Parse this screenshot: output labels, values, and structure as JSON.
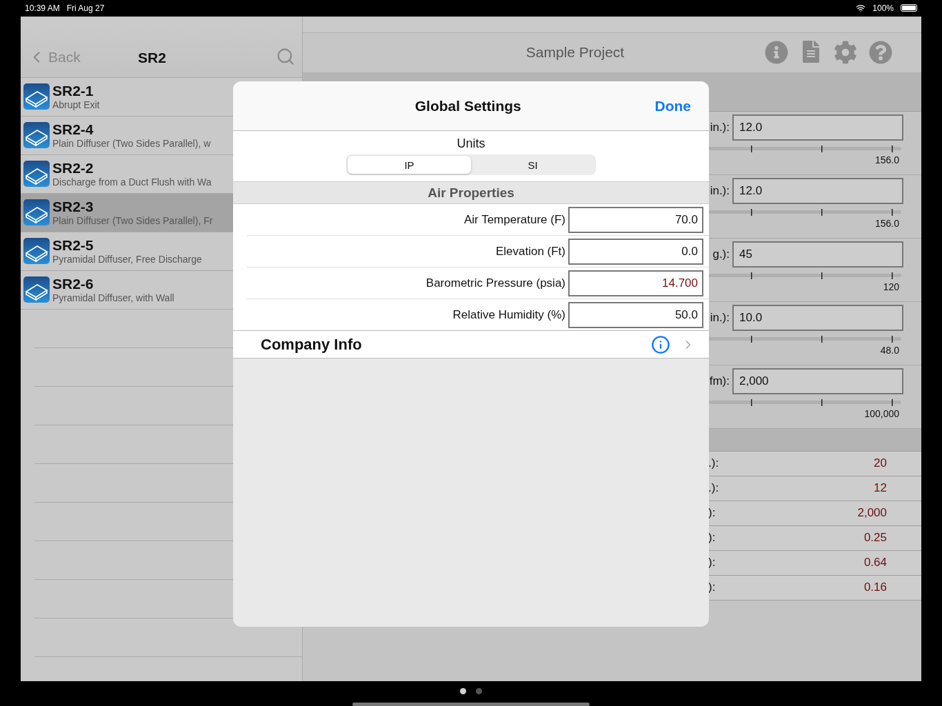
{
  "status_bar": {
    "time": "10:39 AM",
    "date": "Fri Aug 27",
    "battery": "100%"
  },
  "sidebar": {
    "back": "Back",
    "title": "SR2",
    "items": [
      {
        "code": "SR2-1",
        "description": "Abrupt Exit",
        "selected": false
      },
      {
        "code": "SR2-4",
        "description": "Plain Diffuser (Two Sides Parallel), w",
        "selected": false
      },
      {
        "code": "SR2-2",
        "description": "Discharge from a Duct Flush with Wa",
        "selected": false
      },
      {
        "code": "SR2-3",
        "description": "Plain Diffuser (Two Sides Parallel), Fr",
        "selected": true
      },
      {
        "code": "SR2-5",
        "description": "Pyramidal Diffuser, Free Discharge",
        "selected": false
      },
      {
        "code": "SR2-6",
        "description": "Pyramidal Diffuser, with Wall",
        "selected": false
      }
    ]
  },
  "main": {
    "title": "Sample Project",
    "inputs": [
      {
        "label": "in.):",
        "value": "12.0",
        "max": "156.0"
      },
      {
        "label": "in.):",
        "value": "12.0",
        "max": "156.0"
      },
      {
        "label": "g.):",
        "value": "45",
        "max": "120"
      },
      {
        "label": "in.):",
        "value": "10.0",
        "max": "48.0"
      },
      {
        "label": "fm):",
        "value": "2,000",
        "max": "100,000"
      }
    ],
    "results": [
      {
        "label": ".):",
        "value": "20"
      },
      {
        "label": ".):",
        "value": "12"
      },
      {
        "label": "):",
        "value": "2,000"
      },
      {
        "label": "):",
        "value": "0.25"
      },
      {
        "label": "):",
        "value": "0.64"
      },
      {
        "label": "):",
        "value": "0.16"
      }
    ]
  },
  "dialog": {
    "title": "Global Settings",
    "done": "Done",
    "units": {
      "label": "Units",
      "options": [
        {
          "label": "IP",
          "selected": true
        },
        {
          "label": "SI",
          "selected": false
        }
      ]
    },
    "section": "Air Properties",
    "fields": [
      {
        "label": "Air Temperature (F)",
        "value": "70.0",
        "kind": "input"
      },
      {
        "label": "Elevation (Ft)",
        "value": "0.0",
        "kind": "input"
      },
      {
        "label": "Barometric Pressure (psia)",
        "value": "14.700",
        "kind": "computed"
      },
      {
        "label": "Relative Humidity (%)",
        "value": "50.0",
        "kind": "input"
      }
    ],
    "company": {
      "label": "Company Info"
    }
  },
  "pager": [
    {
      "selected": true
    },
    {
      "selected": false
    }
  ]
}
